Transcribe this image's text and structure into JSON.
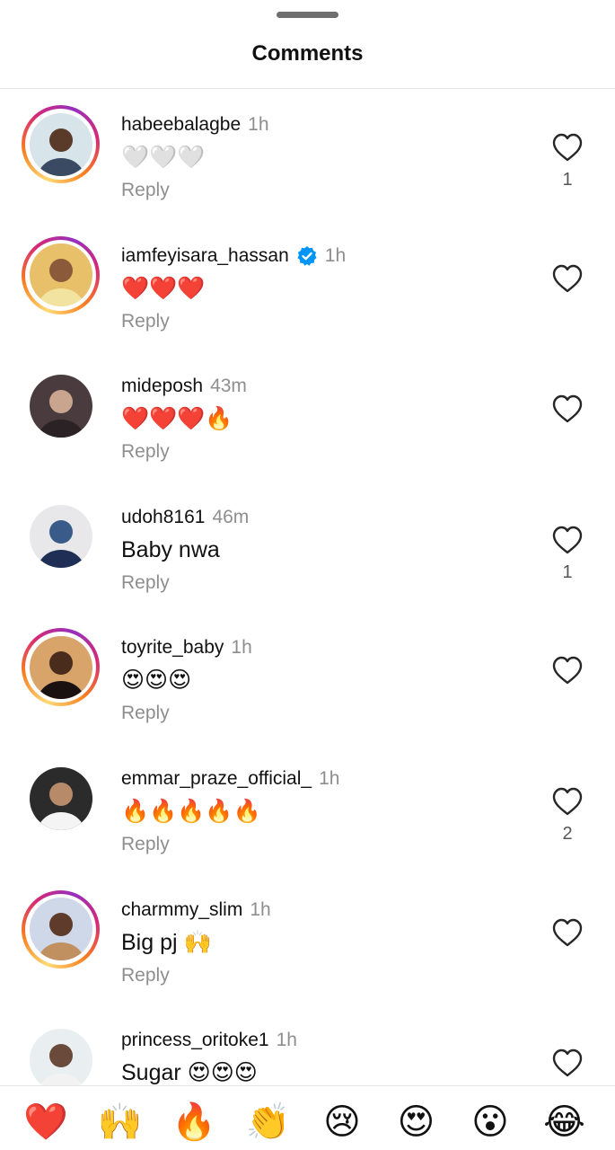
{
  "header": {
    "title": "Comments"
  },
  "comments": [
    {
      "username": "habeebalagbe",
      "time": "1h",
      "text": "🤍🤍🤍",
      "reply": "Reply",
      "likes": "1",
      "verified": false,
      "ring": true
    },
    {
      "username": "iamfeyisara_hassan",
      "time": "1h",
      "text": "❤️❤️❤️",
      "reply": "Reply",
      "likes": "",
      "verified": true,
      "ring": true
    },
    {
      "username": "mideposh",
      "time": "43m",
      "text": "❤️❤️❤️🔥",
      "reply": "Reply",
      "likes": "",
      "verified": false,
      "ring": false
    },
    {
      "username": "udoh8161",
      "time": "46m",
      "text": "Baby nwa",
      "reply": "Reply",
      "likes": "1",
      "verified": false,
      "ring": false
    },
    {
      "username": "toyrite_baby",
      "time": "1h",
      "text": "😍😍😍",
      "reply": "Reply",
      "likes": "",
      "verified": false,
      "ring": true
    },
    {
      "username": "emmar_praze_official_",
      "time": "1h",
      "text": "🔥🔥🔥🔥🔥",
      "reply": "Reply",
      "likes": "2",
      "verified": false,
      "ring": false
    },
    {
      "username": "charmmy_slim",
      "time": "1h",
      "text": "Big pj 🙌",
      "reply": "Reply",
      "likes": "",
      "verified": false,
      "ring": true
    },
    {
      "username": "princess_oritoke1",
      "time": "1h",
      "text": "Sugar 😍😍😍",
      "reply": "",
      "likes": "",
      "verified": false,
      "ring": false
    }
  ],
  "emoji_bar": [
    "❤️",
    "🙌",
    "🔥",
    "👏",
    "😢",
    "😍",
    "😮",
    "😂"
  ],
  "colors": {
    "like_icon": "#262626",
    "secondary_text": "#8e8e8e",
    "verified": "#0095f6"
  }
}
